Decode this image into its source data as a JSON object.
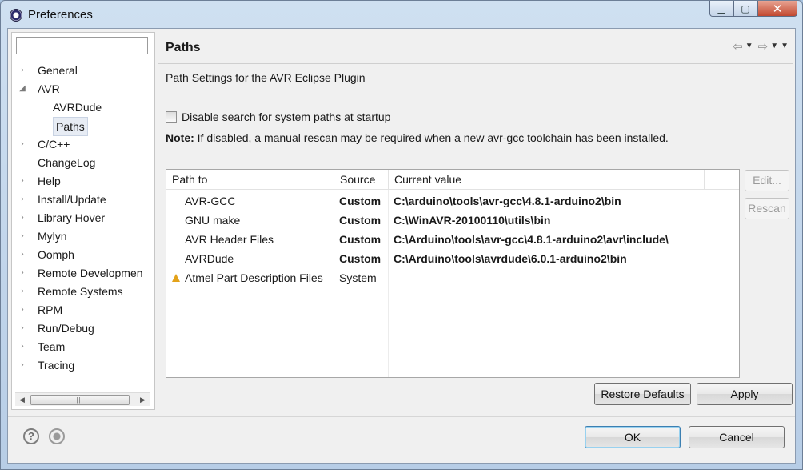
{
  "window": {
    "title": "Preferences"
  },
  "filter": {
    "value": ""
  },
  "tree": {
    "items": [
      {
        "label": "General",
        "twisty": "collapsed"
      },
      {
        "label": "AVR",
        "twisty": "expanded"
      },
      {
        "label": "AVRDude",
        "twisty": "none"
      },
      {
        "label": "Paths",
        "twisty": "none",
        "selected": true
      },
      {
        "label": "C/C++",
        "twisty": "collapsed"
      },
      {
        "label": "ChangeLog",
        "twisty": "none"
      },
      {
        "label": "Help",
        "twisty": "collapsed"
      },
      {
        "label": "Install/Update",
        "twisty": "collapsed"
      },
      {
        "label": "Library Hover",
        "twisty": "collapsed"
      },
      {
        "label": "Mylyn",
        "twisty": "collapsed"
      },
      {
        "label": "Oomph",
        "twisty": "collapsed"
      },
      {
        "label": "Remote Developmen",
        "twisty": "collapsed"
      },
      {
        "label": "Remote Systems",
        "twisty": "collapsed"
      },
      {
        "label": "RPM",
        "twisty": "collapsed"
      },
      {
        "label": "Run/Debug",
        "twisty": "collapsed"
      },
      {
        "label": "Team",
        "twisty": "collapsed"
      },
      {
        "label": "Tracing",
        "twisty": "collapsed"
      }
    ]
  },
  "page": {
    "title": "Paths",
    "description": "Path Settings for the AVR Eclipse Plugin",
    "checkbox_label": "Disable search for system paths at startup",
    "note_label": "Note:",
    "note_text": " If disabled, a manual rescan may be required when a new avr-gcc toolchain has been installed."
  },
  "table": {
    "headers": [
      "Path to",
      "Source",
      "Current value"
    ],
    "rows": [
      {
        "path": "AVR-GCC",
        "source": "Custom",
        "value": "C:\\arduino\\tools\\avr-gcc\\4.8.1-arduino2\\bin",
        "warning": false
      },
      {
        "path": "GNU make",
        "source": "Custom",
        "value": "C:\\WinAVR-20100110\\utils\\bin",
        "warning": false
      },
      {
        "path": "AVR Header Files",
        "source": "Custom",
        "value": "C:\\Arduino\\tools\\avr-gcc\\4.8.1-arduino2\\avr\\include\\",
        "warning": false
      },
      {
        "path": "AVRDude",
        "source": "Custom",
        "value": "C:\\Arduino\\tools\\avrdude\\6.0.1-arduino2\\bin",
        "warning": false
      },
      {
        "path": "Atmel Part Description Files",
        "source": "System",
        "value": "",
        "warning": true
      }
    ]
  },
  "buttons": {
    "edit": "Edit...",
    "rescan": "Rescan",
    "restore_defaults": "Restore Defaults",
    "apply": "Apply",
    "ok": "OK",
    "cancel": "Cancel"
  },
  "icons": {
    "help": "help-icon",
    "record": "record-icon",
    "warning": "warning-icon",
    "back": "back-arrow-icon",
    "forward": "forward-arrow-icon",
    "menu": "view-menu-icon"
  }
}
